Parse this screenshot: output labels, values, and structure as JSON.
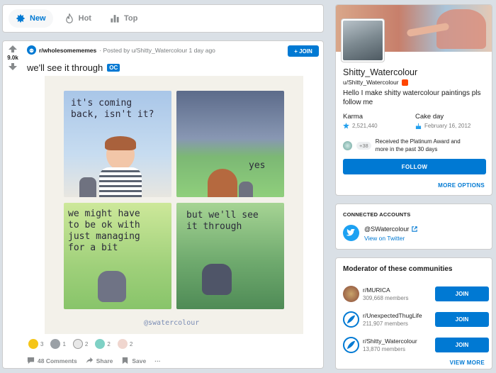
{
  "sortbar": {
    "items": [
      {
        "label": "New",
        "icon": "burst-icon",
        "active": true
      },
      {
        "label": "Hot",
        "icon": "flame-icon",
        "active": false
      },
      {
        "label": "Top",
        "icon": "bar-chart-icon",
        "active": false
      }
    ]
  },
  "post": {
    "score": "9.0k",
    "subreddit": "r/wholesomememes",
    "posted_by": "· Posted by u/Shitty_Watercolour 1 day ago",
    "join_label": "+ JOIN",
    "title": "we'll see it through",
    "flair": "OC",
    "comic": {
      "panel1_text": "it's coming\nback, isn't it?",
      "panel2_text": "yes",
      "panel3_text": "we might have\nto be ok with\njust managing\nfor a bit",
      "panel4_text": "but we'll see\nit through",
      "signature": "@swatercolour"
    },
    "awards": [
      {
        "count": "3",
        "color": "#f5c518"
      },
      {
        "count": "1",
        "color": "#9aa0a6"
      },
      {
        "count": "2",
        "color": "#e8e8e8"
      },
      {
        "count": "2",
        "color": "#7fd1c5"
      },
      {
        "count": "2",
        "color": "#f0d6cf"
      }
    ],
    "actions": {
      "comments": "48 Comments",
      "share": "Share",
      "save": "Save",
      "more": "···"
    }
  },
  "profile": {
    "name": "Shitty_Watercolour",
    "username": "u/Shitty_Watercolour",
    "bio": "Hello I make shitty watercolour paintings pls follow me",
    "karma_label": "Karma",
    "karma_value": "2,521,440",
    "cakeday_label": "Cake day",
    "cakeday_value": "February 16, 2012",
    "trophy_more": "+38",
    "trophy_text": "Received the Platinum Award and more in the past 30 days",
    "follow_label": "FOLLOW",
    "more_options_label": "MORE OPTIONS"
  },
  "connected": {
    "label": "CONNECTED ACCOUNTS",
    "handle": "@SWatercolour",
    "link": "View on Twitter"
  },
  "moderator": {
    "title": "Moderator of these communities",
    "communities": [
      {
        "name": "r/MURICA",
        "members": "309,668 members",
        "join": "JOIN",
        "icon_color": "#8a4b3a"
      },
      {
        "name": "r/UnexpectedThugLife",
        "members": "211,907 members",
        "join": "JOIN",
        "icon_color": "#0079d3"
      },
      {
        "name": "r/Shitty_Watercolour",
        "members": "13,870 members",
        "join": "JOIN",
        "icon_color": "#0079d3"
      }
    ],
    "view_more": "VIEW MORE"
  },
  "colors": {
    "accent": "#0079d3",
    "background": "#dae0e6"
  }
}
